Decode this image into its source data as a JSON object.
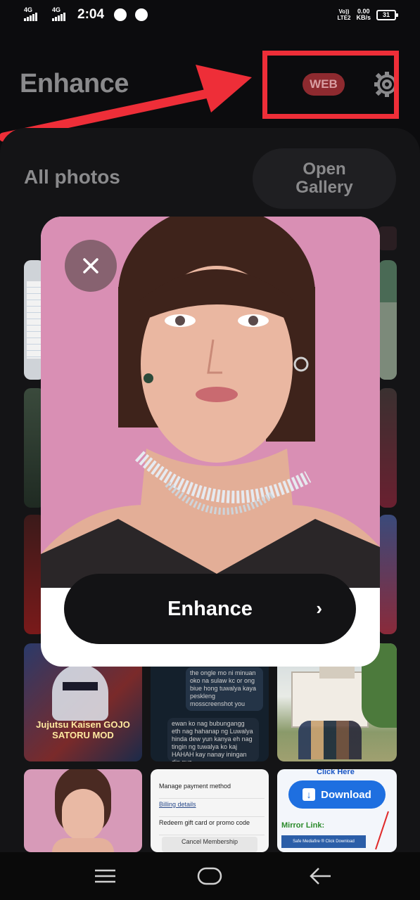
{
  "status_bar": {
    "net1": "4G",
    "net2": "4G",
    "time": "2:04",
    "volte_line1": "Vo))",
    "volte_line2": "LTE2",
    "speed_value": "0.00",
    "speed_unit": "KB/s",
    "battery": "31"
  },
  "header": {
    "title": "Enhance",
    "web_badge": "WEB"
  },
  "gallery": {
    "section_title": "All photos",
    "open_gallery_line1": "Open",
    "open_gallery_line2": "Gallery",
    "thumb_anime_caption": "Jujutsu Kaisen GOJO SATORU MOD",
    "thumb_chat_text1": "the ongle mo ni minuan oko na sulaw kc or ong biue hong tuwalya kaya peskleng mosscreenshot you",
    "thumb_chat_text2": "ewan ko nag bubungangg eth nag hahanap ng Luwalya hinda dew yun kanya eh nag tingin ng tuwalya ko kaj HAHAH kay nanay iningan din nya",
    "thumb_settings_items": [
      "Manage payment method",
      "Billing details",
      "Redeem gift card or promo code"
    ],
    "thumb_settings_button": "Cancel Membership",
    "thumb_download_top": "Click Here",
    "thumb_download_button": "Download",
    "thumb_mirror_label": "Mirror Link:",
    "thumb_mirror_button": "Safe Mediafire ® Click Download"
  },
  "popup": {
    "enhance_button": "Enhance"
  },
  "colors": {
    "background": "#0c0c0e",
    "panel": "#141416",
    "accent_red": "#ee2e38",
    "web_badge": "#8e2a2f",
    "enhance_button": "#131315",
    "photo_bg": "#d98fb4"
  },
  "icons": {
    "close": "close-icon",
    "settings": "gear-icon",
    "chevron": "chevron-right-icon",
    "nav_menu": "menu-icon",
    "nav_home": "home-icon",
    "nav_back": "back-arrow-icon"
  }
}
